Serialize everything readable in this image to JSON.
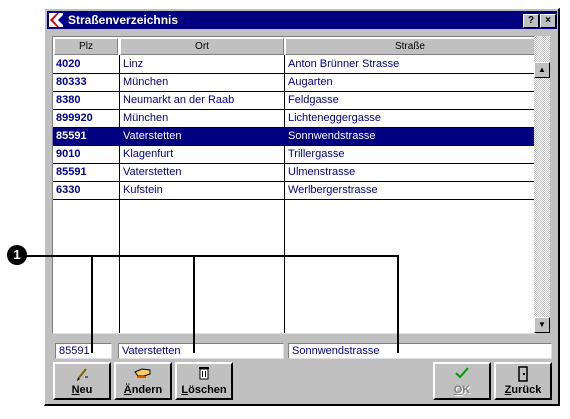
{
  "window": {
    "title": "Straßenverzeichnis",
    "help_label": "?",
    "close_label": "×"
  },
  "table": {
    "columns": [
      "Plz",
      "Ort",
      "Straße"
    ],
    "rows": [
      {
        "plz": "4020",
        "ort": "Linz",
        "strasse": "Anton Brünner Strasse"
      },
      {
        "plz": "80333",
        "ort": "München",
        "strasse": "Augarten"
      },
      {
        "plz": "8380",
        "ort": "Neumarkt an der Raab",
        "strasse": "Feldgasse"
      },
      {
        "plz": "899920",
        "ort": "München",
        "strasse": "Lichteneggergasse"
      },
      {
        "plz": "85591",
        "ort": "Vaterstetten",
        "strasse": "Sonnwendstrasse"
      },
      {
        "plz": "9010",
        "ort": "Klagenfurt",
        "strasse": "Trillergasse"
      },
      {
        "plz": "85591",
        "ort": "Vaterstetten",
        "strasse": "Ulmenstrasse"
      },
      {
        "plz": "6330",
        "ort": "Kufstein",
        "strasse": "Werlbergerstrasse"
      }
    ],
    "selected_row": 4
  },
  "edit": {
    "plz": "85591",
    "ort": "Vaterstetten",
    "strasse": "Sonnwendstrasse"
  },
  "buttons": {
    "neu": {
      "underline": "N",
      "rest": "eu",
      "icon": "pencil-icon"
    },
    "aendern": {
      "underline": "Ä",
      "rest": "ndern",
      "icon": "hand-icon"
    },
    "loeschen": {
      "pre": "",
      "underline": "L",
      "rest": "öschen",
      "icon": "trash-icon"
    },
    "ok": {
      "underline": "O",
      "rest": "K",
      "icon": "checkmark-icon"
    },
    "zurueck": {
      "underline": "Z",
      "rest": "urück",
      "icon": "door-icon"
    }
  },
  "callout": {
    "number": "1"
  },
  "colors": {
    "titlebar": "#000080",
    "selection": "#000080",
    "plz_text": "#00008b",
    "text": "#000080",
    "face": "#c0c0c0"
  }
}
